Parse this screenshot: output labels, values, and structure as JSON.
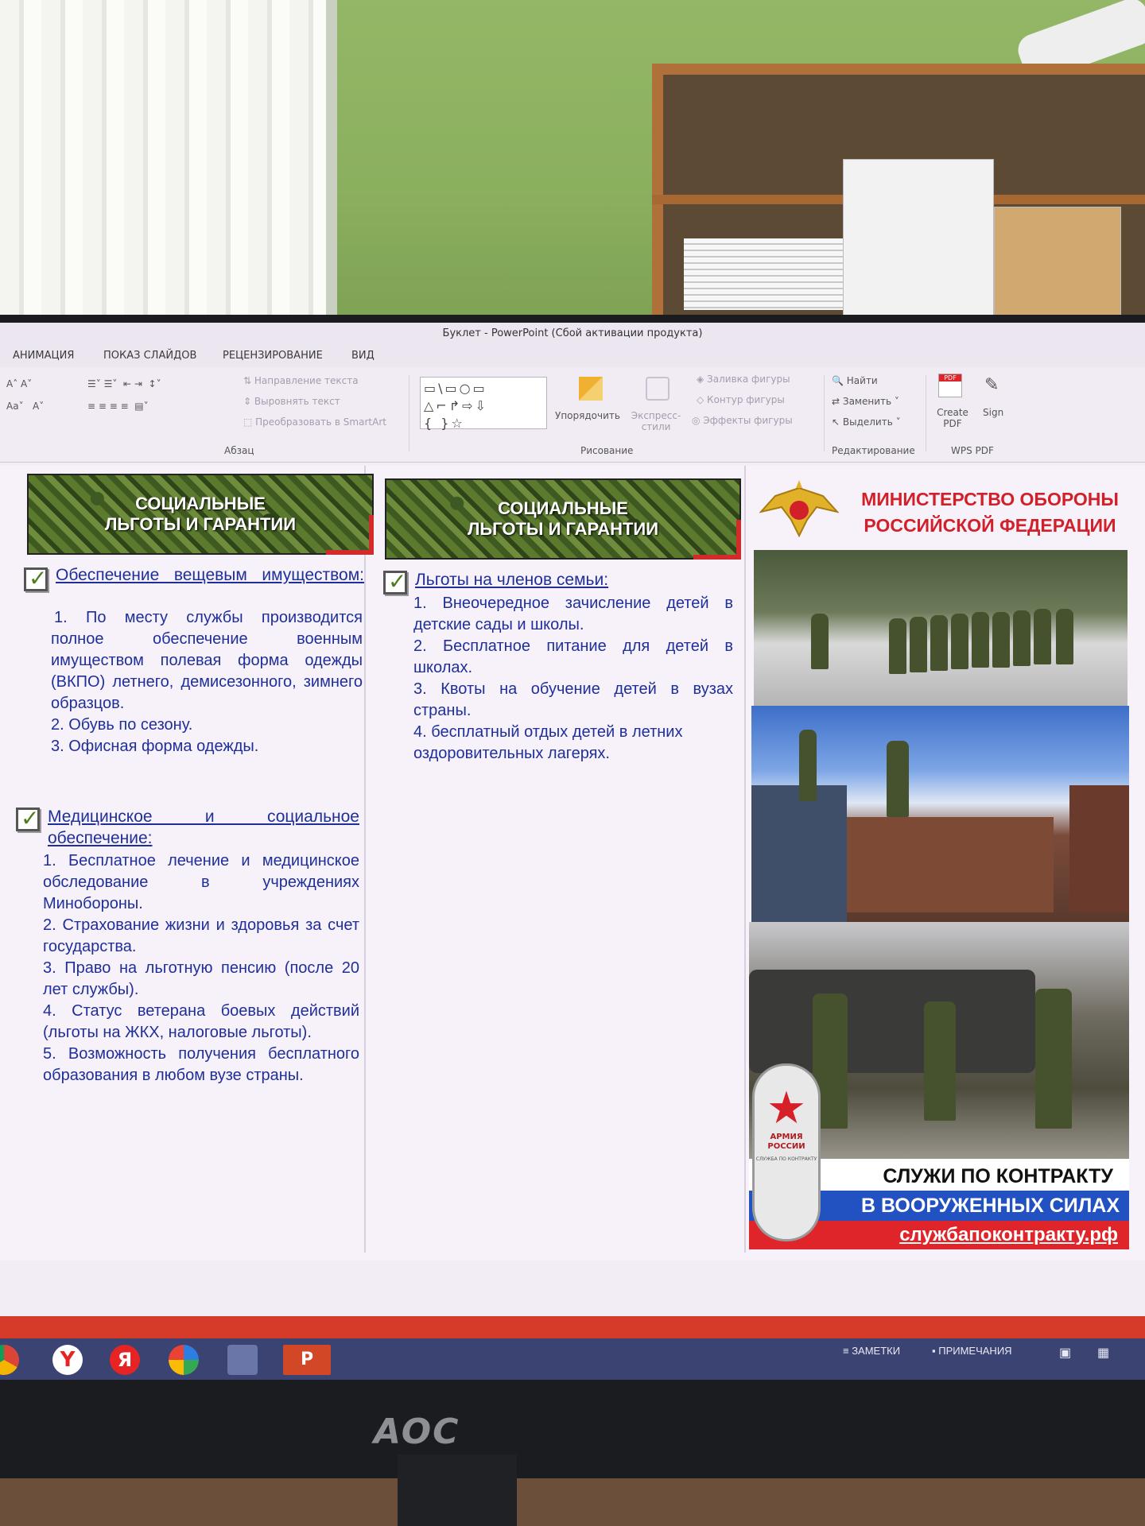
{
  "window": {
    "title": "Буклет - PowerPoint (Сбой активации продукта)"
  },
  "menu_tabs": [
    "АНИМАЦИЯ",
    "ПОКАЗ СЛАЙДОВ",
    "РЕЦЕНЗИРОВАНИЕ",
    "ВИД"
  ],
  "ribbon": {
    "paragraph": {
      "text_direction": "Направление текста",
      "align_text": "Выровнять текст",
      "convert_smartart": "Преобразовать в SmartArt",
      "label": "Абзац"
    },
    "drawing": {
      "arrange": "Упорядочить",
      "quick_styles": "Экспресс-стили",
      "shape_fill": "Заливка фигуры",
      "shape_outline": "Контур фигуры",
      "shape_effects": "Эффекты фигуры",
      "label": "Рисование"
    },
    "editing": {
      "find": "Найти",
      "replace": "Заменить",
      "select": "Выделить",
      "label": "Редактирование"
    },
    "wps": {
      "create_pdf": "Create PDF",
      "sign": "Sign",
      "label": "WPS PDF"
    }
  },
  "slide": {
    "left": {
      "banner": "СОЦИАЛЬНЫЕ\nЛЬГОТЫ И ГАРАНТИИ",
      "section1": {
        "heading": "Обеспечение вещевым имуществом:",
        "items": [
          "1. По месту службы производится полное обеспечение военным имуществом полевая форма одежды (ВКПО) летнего, демисезонного, зимнего образцов.",
          "2. Обувь по сезону.",
          "3. Офисная форма одежды."
        ]
      },
      "section2": {
        "heading": "Медицинское и социальное обеспечение:",
        "items": [
          "1. Бесплатное лечение и медицинское обследование в учреждениях Минобороны.",
          "2. Страхование жизни и здоровья за счет государства.",
          "3. Право на льготную пенсию (после 20 лет службы).",
          "4. Статус ветерана боевых действий (льготы на ЖКХ, налоговые льготы).",
          "5. Возможность получения бесплатного образования в любом вузе страны."
        ]
      }
    },
    "middle": {
      "banner": "СОЦИАЛЬНЫЕ\nЛЬГОТЫ И ГАРАНТИИ",
      "section": {
        "heading": "Льготы на членов семьи:",
        "items": [
          "1. Внеочередное зачисление детей в детские сады и школы.",
          "2. Бесплатное питание для детей в школах.",
          "3. Квоты на обучение детей в вузах страны.",
          "4. бесплатный отдых детей в летних оздоровительных лагерях."
        ]
      }
    },
    "right": {
      "ministry": "МИНИСТЕРСТВО ОБОРОНЫ РОССИЙСКОЙ ФЕДЕРАЦИИ",
      "contract_line1": "СЛУЖИ ПО КОНТРАКТУ",
      "contract_line2": "В ВООРУЖЕННЫХ СИЛАХ",
      "url": "службапоконтракту.рф",
      "badge_label": "АРМИЯ РОССИИ",
      "badge_sub": "СЛУЖБА ПО КОНТРАКТУ"
    }
  },
  "status": {
    "notes": "ЗАМЕТКИ",
    "comments": "ПРИМЕЧАНИЯ"
  },
  "monitor_brand": "AOC",
  "colors": {
    "heading_blue": "#1f2f9a",
    "ministry_red": "#d1202a",
    "band_blue": "#2251c2",
    "band_red": "#e0252a"
  }
}
